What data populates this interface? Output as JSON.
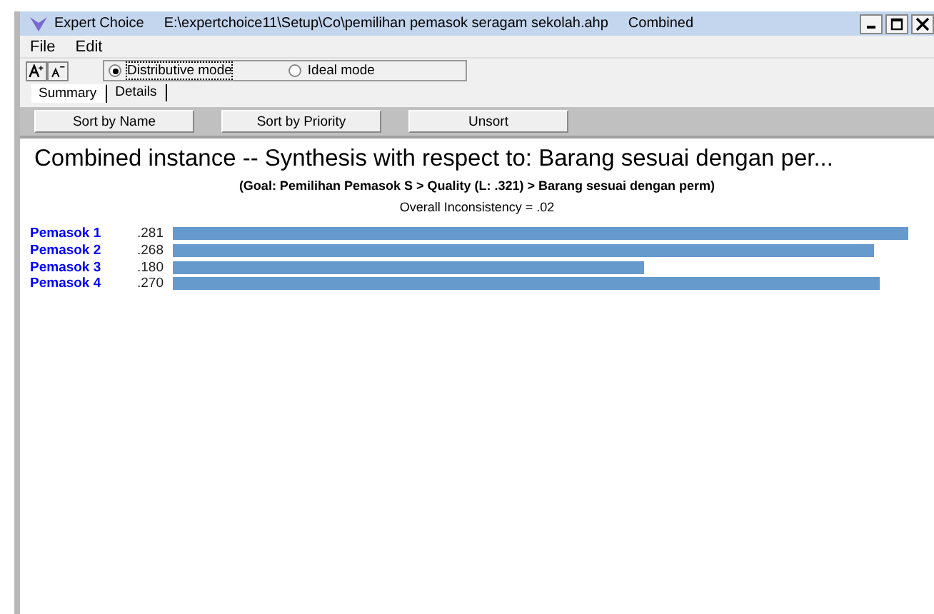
{
  "window": {
    "title": "Expert Choice",
    "file": "E:\\expertchoice11\\Setup\\Co\\pemilihan pemasok seragam sekolah.ahp",
    "mode": "Combined"
  },
  "menu": [
    {
      "label": "File"
    },
    {
      "label": "Edit"
    }
  ],
  "modes": [
    {
      "label": "Distributive mode",
      "selected": true
    },
    {
      "label": "Ideal mode",
      "selected": false
    }
  ],
  "tabs": [
    {
      "label": "Summary",
      "selected": true
    },
    {
      "label": "Details",
      "selected": false
    }
  ],
  "sort_buttons": [
    {
      "label": "Sort by Name"
    },
    {
      "label": "Sort by Priority"
    },
    {
      "label": "Unsort"
    }
  ],
  "heading": "Combined instance -- Synthesis with respect to: Barang sesuai dengan per...",
  "path": "(Goal: Pemilihan Pemasok S > Quality (L: .321) > Barang sesuai dengan perm)",
  "inconsistency": "Overall Inconsistency = .02",
  "rows": [
    {
      "name": "Pemasok 1",
      "value": ".281"
    },
    {
      "name": "Pemasok 2",
      "value": ".268"
    },
    {
      "name": "Pemasok 3",
      "value": ".180"
    },
    {
      "name": "Pemasok 4",
      "value": ".270"
    }
  ]
}
